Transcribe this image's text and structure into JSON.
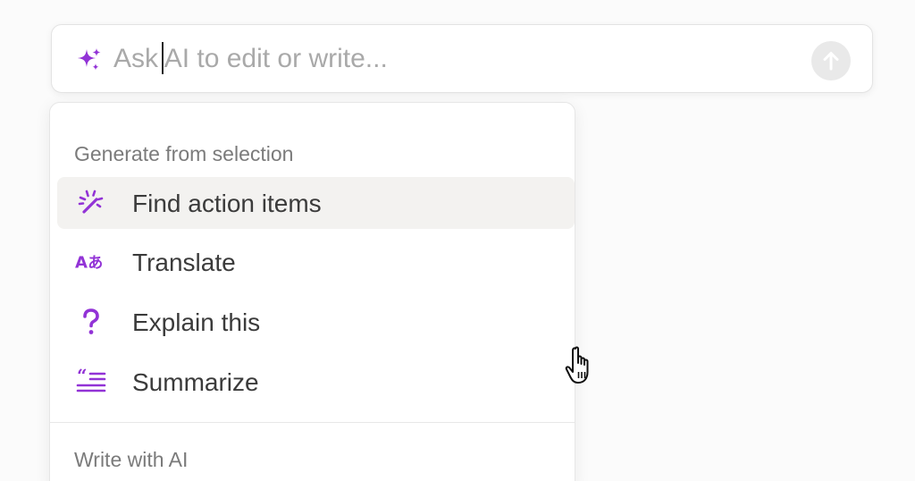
{
  "ask_bar": {
    "placeholder": "Ask AI to edit or write...",
    "value": "",
    "icon": "sparkle-icon",
    "send_icon": "arrow-up-icon"
  },
  "menu": {
    "sections": [
      {
        "label": "Generate from selection",
        "items": [
          {
            "label": "Find action items",
            "icon": "magic-wand-icon",
            "active": true
          },
          {
            "label": "Translate",
            "icon": "translate-icon"
          },
          {
            "label": "Explain this",
            "icon": "question-icon"
          },
          {
            "label": "Summarize",
            "icon": "summarize-icon"
          }
        ]
      },
      {
        "label": "Write with AI",
        "items": []
      }
    ]
  },
  "colors": {
    "accent": "#9233d6",
    "active_row": "#f3f2f0",
    "muted_text": "#7b7b7b",
    "placeholder": "#a9a9a9"
  }
}
